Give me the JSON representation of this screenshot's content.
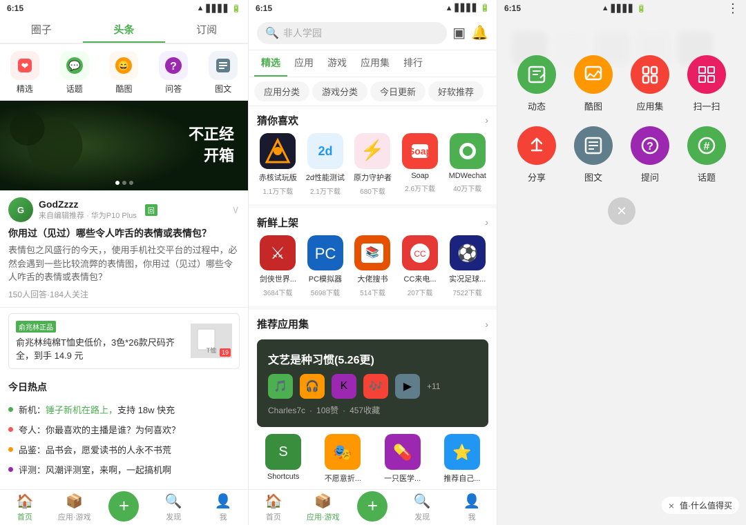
{
  "left_panel": {
    "status_time": "6:15",
    "tabs": [
      "圈子",
      "头条",
      "订阅"
    ],
    "active_tab": 1,
    "icons": [
      {
        "label": "精选",
        "color": "#ff5252",
        "bg": "#fff0f0",
        "icon": "❤"
      },
      {
        "label": "话题",
        "color": "#4caf50",
        "bg": "#f0fff0",
        "icon": "💬"
      },
      {
        "label": "酷图",
        "color": "#ff9800",
        "bg": "#fff8f0",
        "icon": "😄"
      },
      {
        "label": "问答",
        "color": "#9c27b0",
        "bg": "#f5f0ff",
        "icon": "?"
      },
      {
        "label": "图文",
        "color": "#607d8b",
        "bg": "#f0f4f8",
        "icon": "≡"
      }
    ],
    "banner_text": "不正经\n开箱",
    "post": {
      "username": "GodZzzz",
      "source": "来自编辑推荐",
      "device": "华为P10 Plus",
      "tag": "回",
      "title": "你用过（见过）哪些令人咋舌的表情或表情包？",
      "content": "表情包之风盛行的今天，，使用手机社交平台的过程中，必然会遇到一些比较流弊的表情图，你用过（见过）哪些令人咋舌的表情或表情包？",
      "stats": "150人回答·184人关注"
    },
    "ad": {
      "tag": "俞兆林正品",
      "text": "俞兆林纯棉T恤史低价，3色*26款尺码齐全，到手 14.9 元"
    },
    "hot_title": "今日热点",
    "hot_items": [
      {
        "dot_color": "#4caf50",
        "text": "新机：锤子新机在路上，支持 18w 快充",
        "highlight": "锤子新机在路上，"
      },
      {
        "dot_color": "#ff5252",
        "text": "夸人：你最喜欢的主播是谁？为何喜欢？"
      },
      {
        "dot_color": "#ff9800",
        "text": "品鉴：品书会，愿爱读书的人永不书荒"
      },
      {
        "dot_color": "#9c27b0",
        "text": "评测：风潮评测室，来啊，一起搞机啊"
      }
    ],
    "nav": [
      {
        "label": "首页",
        "active": true,
        "icon": "🏠"
      },
      {
        "label": "应用·游戏",
        "active": false,
        "icon": "📦"
      },
      {
        "label": "",
        "active": false,
        "fab": true
      },
      {
        "label": "发现",
        "active": false,
        "icon": "🔍"
      },
      {
        "label": "我",
        "active": false,
        "icon": "👤"
      }
    ]
  },
  "mid_panel": {
    "status_time": "6:15",
    "search_placeholder": "非人学园",
    "tabs": [
      "精选",
      "应用",
      "游戏",
      "应用集",
      "排行"
    ],
    "active_tab": 0,
    "sub_tabs": [
      "应用分类",
      "游戏分类",
      "今日更新",
      "好软推荐"
    ],
    "recommend_title": "猜你喜欢",
    "recommend_apps": [
      {
        "name": "赤核试玩版",
        "dl": "1.1万下载",
        "color": "#333",
        "icon": "⬟"
      },
      {
        "name": "2d性能测试",
        "dl": "2.1万下载",
        "color": "#2196f3",
        "icon": "2d"
      },
      {
        "name": "原力守护者",
        "dl": "680下载",
        "color": "#e91e63",
        "icon": "⚡"
      },
      {
        "name": "Soap",
        "dl": "2.6万下载",
        "color": "#f44336",
        "icon": "🧼"
      },
      {
        "name": "MDWechat",
        "dl": "40万下载",
        "color": "#4caf50",
        "icon": "◉"
      }
    ],
    "new_title": "新鲜上架",
    "new_apps": [
      {
        "name": "剑侠世界...",
        "dl": "3684下载",
        "color": "#c62828",
        "icon": "⚔"
      },
      {
        "name": "PC模拟器",
        "dl": "5698下载",
        "color": "#1565c0",
        "icon": "💻"
      },
      {
        "name": "大佬搜书",
        "dl": "514下载",
        "color": "#e65100",
        "icon": "📚"
      },
      {
        "name": "CC来电...",
        "dl": "207下载",
        "color": "#e53935",
        "icon": "📞"
      },
      {
        "name": "实况足球...",
        "dl": "7522下载",
        "color": "#1a237e",
        "icon": "⚽"
      }
    ],
    "rec_collection_title": "推荐应用集",
    "collection_card": {
      "title": "文艺是种习惯(5.26更)",
      "user": "Charles7c",
      "likes": "108赞",
      "favorites": "457收藏"
    },
    "shortcuts_title": "Shortcuts",
    "shortcuts": [
      {
        "name": "Shortcuts",
        "color": "#4caf50"
      },
      {
        "name": "不愿意折...",
        "color": "#ff9800"
      },
      {
        "name": "一只医学...",
        "color": "#9c27b0"
      },
      {
        "name": "推荐自己...",
        "color": "#2196f3"
      }
    ],
    "nav": [
      {
        "label": "首页",
        "active": false,
        "icon": "🏠"
      },
      {
        "label": "应用·游戏",
        "active": true,
        "icon": "📦"
      },
      {
        "label": "",
        "active": false,
        "fab": true
      },
      {
        "label": "发现",
        "active": false,
        "icon": "🔍"
      },
      {
        "label": "我",
        "active": false,
        "icon": "👤"
      }
    ]
  },
  "right_panel": {
    "status_time": "6:15",
    "quick_actions_row1": [
      {
        "label": "动态",
        "icon": "✏",
        "color": "#4caf50"
      },
      {
        "label": "酷图",
        "icon": "🖼",
        "color": "#ff9800"
      },
      {
        "label": "应用集",
        "icon": "📋",
        "color": "#f44336"
      },
      {
        "label": "扫一扫",
        "icon": "⊞",
        "color": "#e91e63"
      }
    ],
    "quick_actions_row2": [
      {
        "label": "分享",
        "icon": "↩",
        "color": "#f44336"
      },
      {
        "label": "图文",
        "icon": "≡",
        "color": "#607d8b"
      },
      {
        "label": "提问",
        "icon": "?",
        "color": "#9c27b0"
      },
      {
        "label": "话题",
        "icon": "#",
        "color": "#4caf50"
      }
    ],
    "close_label": "×",
    "watermark": "× 值·什么值得买"
  }
}
